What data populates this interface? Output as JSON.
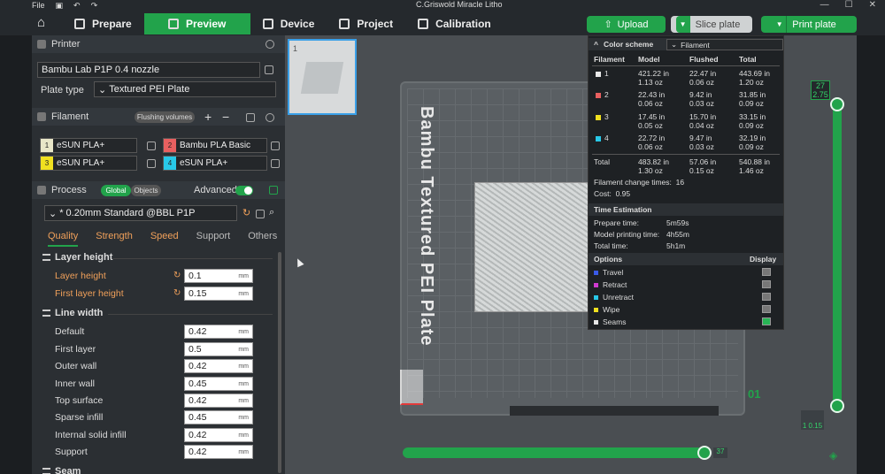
{
  "window": {
    "title": "C.Griswold Miracle Litho",
    "menu": "File",
    "controls": [
      "—",
      "☐",
      "✕"
    ]
  },
  "tabs": [
    {
      "label": "Prepare",
      "active": false
    },
    {
      "label": "Preview",
      "active": true
    },
    {
      "label": "Device",
      "active": false
    },
    {
      "label": "Project",
      "active": false
    },
    {
      "label": "Calibration",
      "active": false
    }
  ],
  "actions": {
    "upload": "Upload",
    "slice": "Slice plate",
    "print": "Print plate"
  },
  "printer": {
    "heading": "Printer",
    "name": "Bambu Lab P1P 0.4 nozzle",
    "plate_type_label": "Plate type",
    "plate_type": "Textured PEI Plate"
  },
  "filament": {
    "heading": "Filament",
    "flushing": "Flushing volumes",
    "slots": [
      {
        "num": "1",
        "name": "eSUN PLA+",
        "color": "#e8e6c8"
      },
      {
        "num": "2",
        "name": "Bambu PLA Basic",
        "color": "#e86060"
      },
      {
        "num": "3",
        "name": "eSUN PLA+",
        "color": "#f0e020"
      },
      {
        "num": "4",
        "name": "eSUN PLA+",
        "color": "#28c8e8"
      }
    ]
  },
  "process": {
    "heading": "Process",
    "global": "Global",
    "objects": "Objects",
    "advanced": "Advanced",
    "preset": "* 0.20mm Standard @BBL P1P",
    "tabs": [
      "Quality",
      "Strength",
      "Speed",
      "Support",
      "Others"
    ]
  },
  "layer_height": {
    "heading": "Layer height",
    "rows": [
      {
        "label": "Layer height",
        "value": "0.1",
        "unit": "mm"
      },
      {
        "label": "First layer height",
        "value": "0.15",
        "unit": "mm"
      }
    ]
  },
  "line_width": {
    "heading": "Line width",
    "rows": [
      {
        "label": "Default",
        "value": "0.42",
        "unit": "mm"
      },
      {
        "label": "First layer",
        "value": "0.5",
        "unit": "mm"
      },
      {
        "label": "Outer wall",
        "value": "0.42",
        "unit": "mm"
      },
      {
        "label": "Inner wall",
        "value": "0.45",
        "unit": "mm"
      },
      {
        "label": "Top surface",
        "value": "0.42",
        "unit": "mm"
      },
      {
        "label": "Sparse infill",
        "value": "0.45",
        "unit": "mm"
      },
      {
        "label": "Internal solid infill",
        "value": "0.42",
        "unit": "mm"
      },
      {
        "label": "Support",
        "value": "0.42",
        "unit": "mm"
      }
    ],
    "next_heading": "Seam"
  },
  "plate": {
    "number": "1",
    "bed_text": "Bambu Textured PEI Plate"
  },
  "slider": {
    "top": [
      "27",
      "2.75"
    ],
    "bottom": "1",
    "bottom_sub": "0.15",
    "layer_marker": "01",
    "horizontal_val": "37"
  },
  "stats": {
    "color_scheme_label": "Color scheme",
    "color_scheme_value": "Filament",
    "headers": [
      "Filament",
      "Model",
      "Flushed",
      "Total"
    ],
    "rows": [
      {
        "num": "1",
        "color": "#e8e8e8",
        "model": [
          "421.22 in",
          "1.13 oz"
        ],
        "flushed": [
          "22.47 in",
          "0.06 oz"
        ],
        "total": [
          "443.69 in",
          "1.20 oz"
        ]
      },
      {
        "num": "2",
        "color": "#e86060",
        "model": [
          "22.43 in",
          "0.06 oz"
        ],
        "flushed": [
          "9.42 in",
          "0.03 oz"
        ],
        "total": [
          "31.85 in",
          "0.09 oz"
        ]
      },
      {
        "num": "3",
        "color": "#f0e020",
        "model": [
          "17.45 in",
          "0.05 oz"
        ],
        "flushed": [
          "15.70 in",
          "0.04 oz"
        ],
        "total": [
          "33.15 in",
          "0.09 oz"
        ]
      },
      {
        "num": "4",
        "color": "#28c8e8",
        "model": [
          "22.72 in",
          "0.06 oz"
        ],
        "flushed": [
          "9.47 in",
          "0.03 oz"
        ],
        "total": [
          "32.19 in",
          "0.09 oz"
        ]
      }
    ],
    "total": {
      "label": "Total",
      "model": [
        "483.82 in",
        "1.30 oz"
      ],
      "flushed": [
        "57.06 in",
        "0.15 oz"
      ],
      "total": [
        "540.88 in",
        "1.46 oz"
      ]
    },
    "change_times_label": "Filament change times:",
    "change_times": "16",
    "cost_label": "Cost:",
    "cost": "0.95",
    "time_heading": "Time Estimation",
    "times": [
      {
        "label": "Prepare time:",
        "value": "5m59s"
      },
      {
        "label": "Model printing time:",
        "value": "4h55m"
      },
      {
        "label": "Total time:",
        "value": "5h1m"
      }
    ],
    "options_label": "Options",
    "display_label": "Display",
    "options": [
      {
        "label": "Travel",
        "color": "#3a5ae8",
        "on": false
      },
      {
        "label": "Retract",
        "color": "#d03ad0",
        "on": false
      },
      {
        "label": "Unretract",
        "color": "#28c8e8",
        "on": false
      },
      {
        "label": "Wipe",
        "color": "#f0e020",
        "on": false
      },
      {
        "label": "Seams",
        "color": "#e8e8e8",
        "on": true
      }
    ]
  }
}
